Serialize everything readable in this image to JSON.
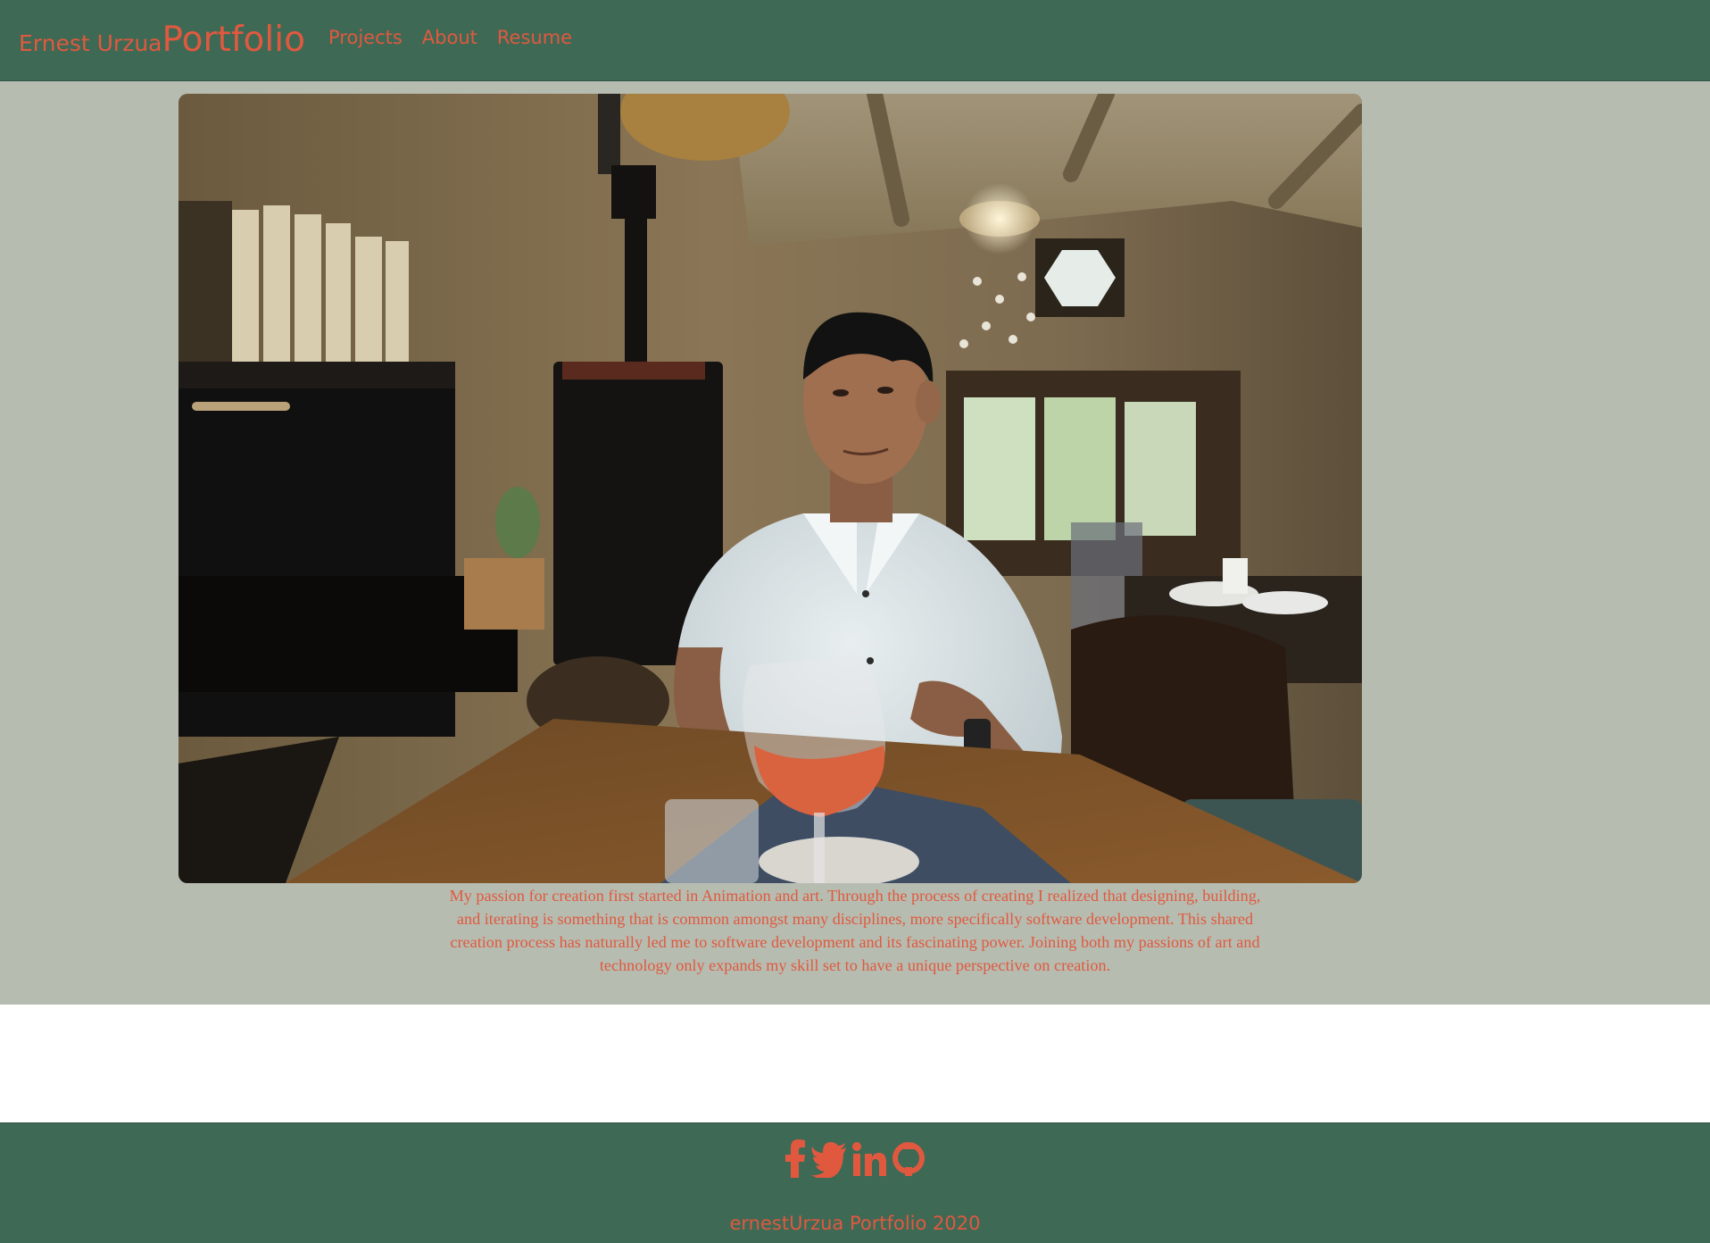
{
  "navbar": {
    "brand_name": "Ernest Urzua",
    "brand_portfolio": "Portfolio",
    "links": [
      {
        "label": "Projects"
      },
      {
        "label": "About"
      },
      {
        "label": "Resume"
      }
    ]
  },
  "main": {
    "photo_icon": "portrait-photo",
    "bio": "My passion for creation first started in Animation and art. Through the process of creating I realized that designing, building, and iterating is something that is common amongst many disciplines, more specifically software development. This shared creation process has naturally led me to software development and its fascinating power. Joining both my passions of art and technology only expands my skill set to have a unique perspective on creation."
  },
  "footer": {
    "socials": [
      {
        "icon": "facebook-icon"
      },
      {
        "icon": "twitter-icon"
      },
      {
        "icon": "linkedin-icon"
      },
      {
        "icon": "github-icon"
      }
    ],
    "copyright": "ernestUrzua Portfolio 2020"
  },
  "colors": {
    "header_bg": "#3e6955",
    "page_bg": "#b7bcb0",
    "accent": "#e0593f"
  }
}
